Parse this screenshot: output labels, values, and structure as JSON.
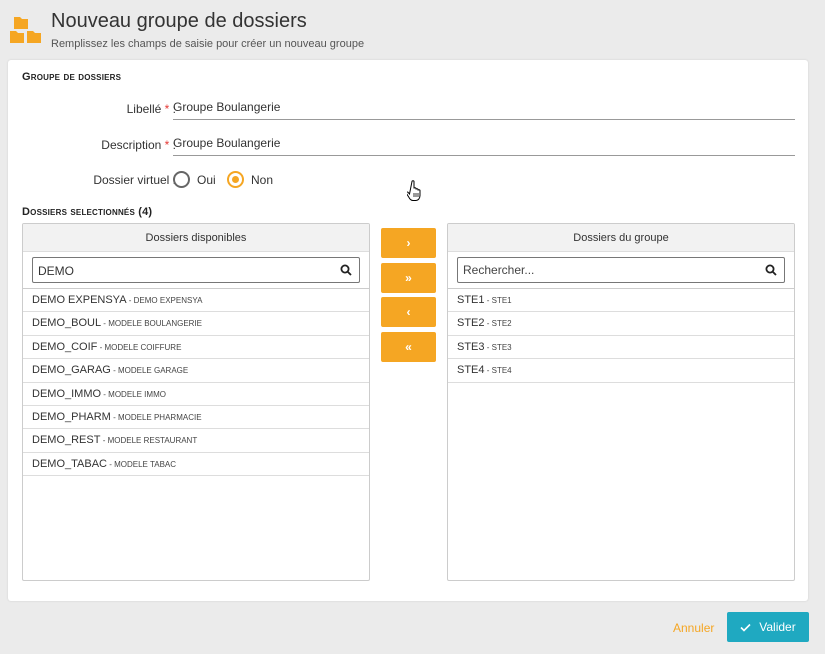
{
  "header": {
    "title": "Nouveau groupe de dossiers",
    "subtitle": "Remplissez les champs de saisie pour créer un nouveau groupe",
    "icon": "folders-icon",
    "accent_color": "#f5a623"
  },
  "form": {
    "section_title": "Groupe de dossiers",
    "libelle": {
      "label": "Libellé",
      "required_mark": "*",
      "colon": " :",
      "value": "Groupe Boulangerie"
    },
    "description": {
      "label": "Description",
      "required_mark": "*",
      "colon": " :",
      "value": "Groupe Boulangerie"
    },
    "dossier_virtuel": {
      "label": "Dossier virtuel :",
      "options": [
        {
          "label": "Oui",
          "checked": false
        },
        {
          "label": "Non",
          "checked": true
        }
      ]
    }
  },
  "selection": {
    "section_title": "Dossiers selectionnés (4)",
    "available": {
      "header": "Dossiers disponibles",
      "search_value": "DEMO",
      "items": [
        {
          "code": "DEMO EXPENSYA",
          "name": "DEMO EXPENSYA"
        },
        {
          "code": "DEMO_BOUL",
          "name": "MODELE BOULANGERIE"
        },
        {
          "code": "DEMO_COIF",
          "name": "MODELE COIFFURE"
        },
        {
          "code": "DEMO_GARAG",
          "name": "MODELE GARAGE"
        },
        {
          "code": "DEMO_IMMO",
          "name": "MODELE IMMO"
        },
        {
          "code": "DEMO_PHARM",
          "name": "MODELE PHARMACIE"
        },
        {
          "code": "DEMO_REST",
          "name": "MODELE RESTAURANT"
        },
        {
          "code": "DEMO_TABAC",
          "name": "MODELE TABAC"
        }
      ]
    },
    "group": {
      "header": "Dossiers du groupe",
      "search_placeholder": "Rechercher...",
      "items": [
        {
          "code": "STE1",
          "name": "STE1"
        },
        {
          "code": "STE2",
          "name": "STE2"
        },
        {
          "code": "STE3",
          "name": "STE3"
        },
        {
          "code": "STE4",
          "name": "STE4"
        }
      ]
    },
    "buttons": {
      "add_one": "›",
      "add_all": "»",
      "remove_one": "‹",
      "remove_all": "«"
    }
  },
  "footer": {
    "cancel_label": "Annuler",
    "validate_label": "Valider",
    "validate_color": "#1fa9c1"
  }
}
